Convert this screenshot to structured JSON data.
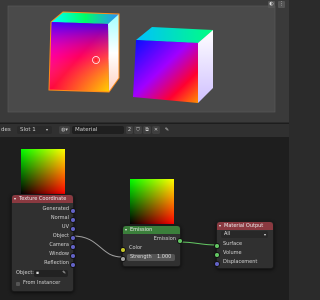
{
  "header": {
    "mode_label": "des",
    "slot_label": "Slot 1",
    "material_name": "Material",
    "user_count": "2"
  },
  "nodes": {
    "texture_coordinate": {
      "title": "Texture Coordinate",
      "outputs": [
        "Generated",
        "Normal",
        "UV",
        "Object",
        "Camera",
        "Window",
        "Reflection"
      ],
      "object_label": "Object:",
      "from_instancer_label": "From Instancer"
    },
    "emission": {
      "title": "Emission",
      "output": "Emission",
      "inputs": {
        "color_label": "Color",
        "strength_label": "Strength",
        "strength_value": "1.000"
      }
    },
    "material_output": {
      "title": "Material Output",
      "target": "All",
      "inputs": [
        "Surface",
        "Volume",
        "Displacement"
      ]
    }
  },
  "colors": {
    "texture_node_header": "#8a3940",
    "shader_node_header": "#3b7f3b",
    "output_node_header": "#8a3940",
    "selection_outline": "#ff8c1a"
  }
}
